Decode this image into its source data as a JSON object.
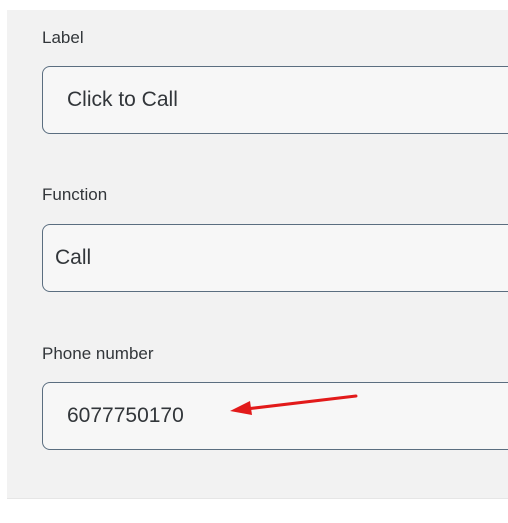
{
  "form": {
    "fields": [
      {
        "label": "Label",
        "value": "Click to Call"
      },
      {
        "label": "Function",
        "value": "Call"
      },
      {
        "label": "Phone number",
        "value": "6077750170"
      }
    ]
  },
  "annotation": {
    "arrow_color": "#e21a1a"
  },
  "colors": {
    "panel_background": "#f2f2f2",
    "field_border": "#5b6e80",
    "text": "#32363a"
  }
}
